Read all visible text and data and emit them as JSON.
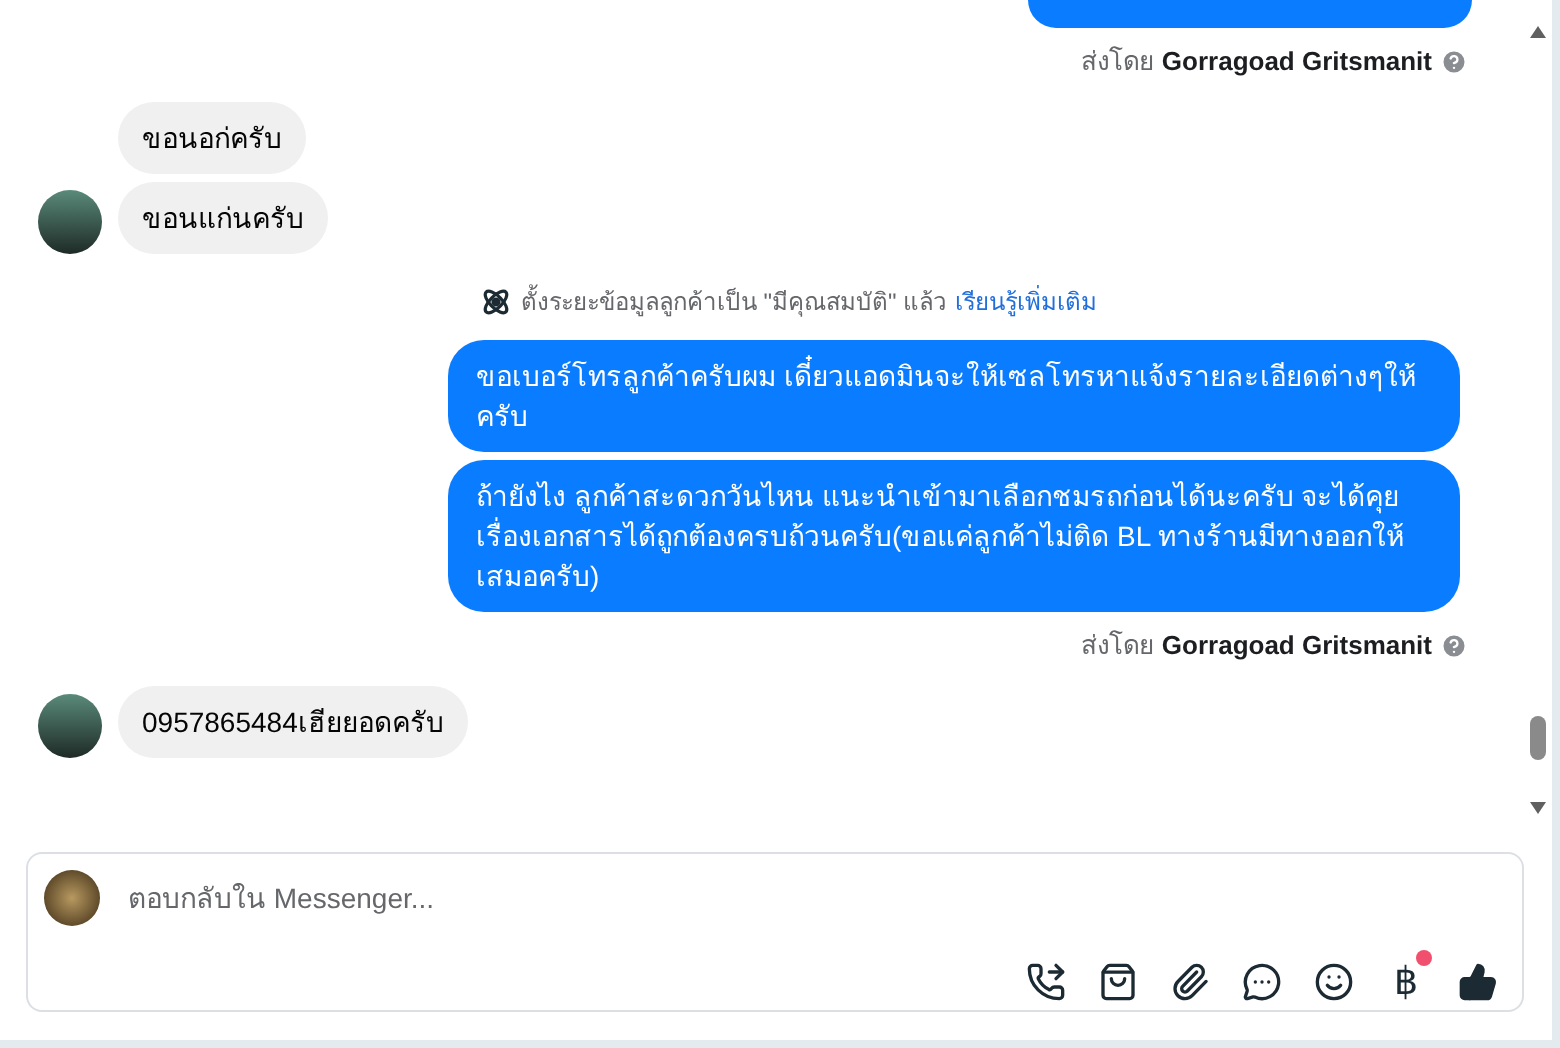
{
  "messages": [
    {
      "kind": "cut_bubble"
    },
    {
      "kind": "sent_by",
      "label": "ส่งโดย",
      "name": "Gorragoad Gritsmanit"
    },
    {
      "kind": "incoming",
      "bubbles": [
        "ขอนอก่ครับ",
        "ขอนแก่นครับ"
      ]
    },
    {
      "kind": "system",
      "text": "ตั้งระยะข้อมูลลูกค้าเป็น \"มีคุณสมบัติ\" แล้ว",
      "link": "เรียนรู้เพิ่มเติม"
    },
    {
      "kind": "outgoing",
      "bubbles": [
        "ขอเบอร์โทรลูกค้าครับผม เดี๋ยวแอดมินจะให้เซลโทรหาแจ้งรายละเอียดต่างๆให้ครับ",
        "ถ้ายังไง ลูกค้าสะดวกวันไหน แนะนำเข้ามาเลือกชมรถก่อนได้นะครับ จะได้คุยเรื่องเอกสารได้ถูกต้องครบถ้วนครับ(ขอแค่ลูกค้าไม่ติด BL ทางร้านมีทางออกให้เสมอครับ)"
      ]
    },
    {
      "kind": "sent_by",
      "label": "ส่งโดย",
      "name": "Gorragoad Gritsmanit"
    },
    {
      "kind": "incoming",
      "bubbles": [
        "0957865484เฮียยอดครับ"
      ]
    }
  ],
  "composer": {
    "placeholder": "ตอบกลับใน Messenger...",
    "currency": "฿",
    "currency_notification": true
  }
}
